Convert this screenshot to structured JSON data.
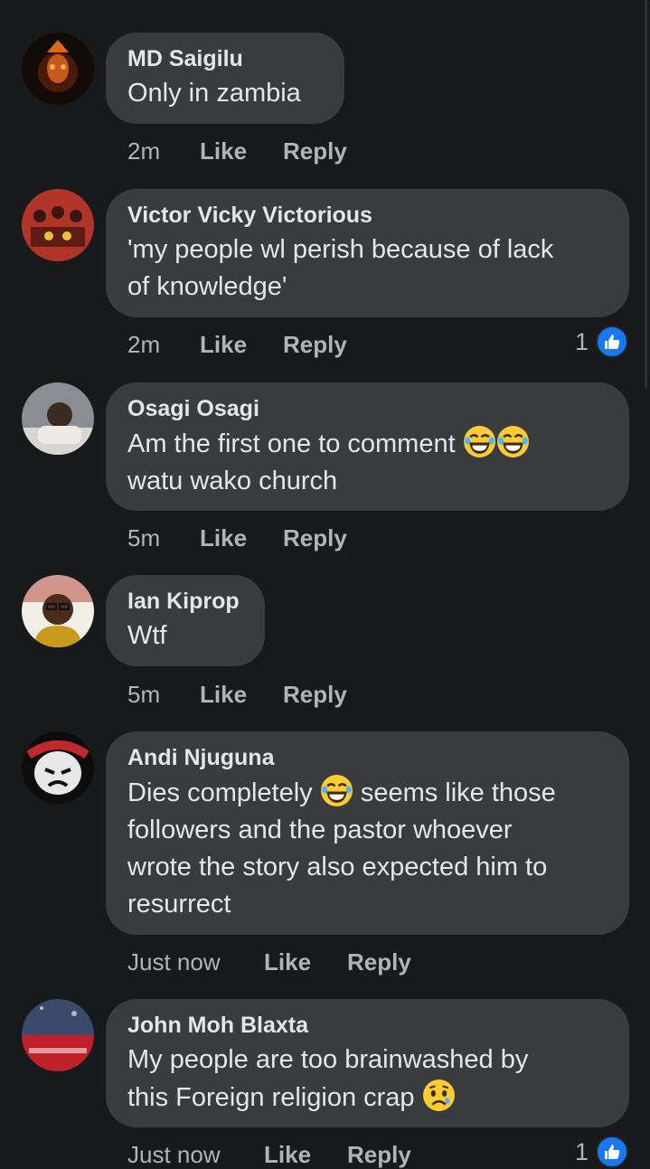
{
  "comments": [
    {
      "author": "MD Saigilu",
      "lines": [
        "Only in zambia"
      ],
      "time": "2m",
      "like": "Like",
      "reply": "Reply",
      "reactions": null
    },
    {
      "author": "Victor Vicky Victorious",
      "lines": [
        "'my people wl perish because of lack",
        "of knowledge'"
      ],
      "time": "2m",
      "like": "Like",
      "reply": "Reply",
      "reactions": "1"
    },
    {
      "author": "Osagi  Osagi",
      "lines": [
        "Am the first one to comment",
        "watu wako church"
      ],
      "time": "5m",
      "like": "Like",
      "reply": "Reply",
      "reactions": null
    },
    {
      "author": "Ian Kiprop",
      "lines": [
        "Wtf"
      ],
      "time": "5m",
      "like": "Like",
      "reply": "Reply",
      "reactions": null
    },
    {
      "author": "Andi Njuguna",
      "lines": [
        "Dies completely",
        "seems like those",
        "followers and the pastor whoever",
        "wrote the story also expected him to",
        "resurrect"
      ],
      "time": "Just now",
      "like": "Like",
      "reply": "Reply",
      "reactions": null
    },
    {
      "author": "John Moh Blaxta",
      "lines": [
        "My people are too brainwashed by",
        "this Foreign religion crap"
      ],
      "time": "Just now",
      "like": "Like",
      "reply": "Reply",
      "reactions": "1"
    }
  ],
  "colors": {
    "background": "#18191a",
    "bubble": "#3a3b3c",
    "text": "#e4e6eb",
    "meta": "#b0b3b8",
    "like_blue": "#1877f2"
  }
}
